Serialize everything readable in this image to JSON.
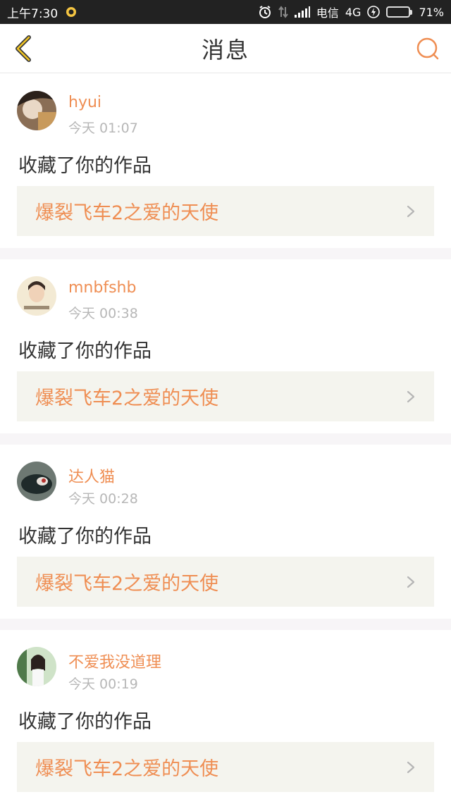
{
  "status_bar": {
    "time": "上午7:30",
    "carrier": "电信",
    "network": "4G",
    "battery_percent": "71%",
    "battery_level": 0.71
  },
  "header": {
    "title": "消息",
    "back_icon": "chevron-left-icon",
    "search_icon": "search-icon",
    "accent_color": "#ef8e53"
  },
  "messages": [
    {
      "user": "hyui",
      "time": "今天 01:07",
      "action": "收藏了你的作品",
      "work_title": "爆裂飞车2之爱的天使"
    },
    {
      "user": "mnbfshb",
      "time": "今天 00:38",
      "action": "收藏了你的作品",
      "work_title": "爆裂飞车2之爱的天使"
    },
    {
      "user": "达人猫",
      "time": "今天 00:28",
      "action": "收藏了你的作品",
      "work_title": "爆裂飞车2之爱的天使"
    },
    {
      "user": "不爱我没道理",
      "time": "今天 00:19",
      "action": "收藏了你的作品",
      "work_title": "爆裂飞车2之爱的天使"
    }
  ]
}
